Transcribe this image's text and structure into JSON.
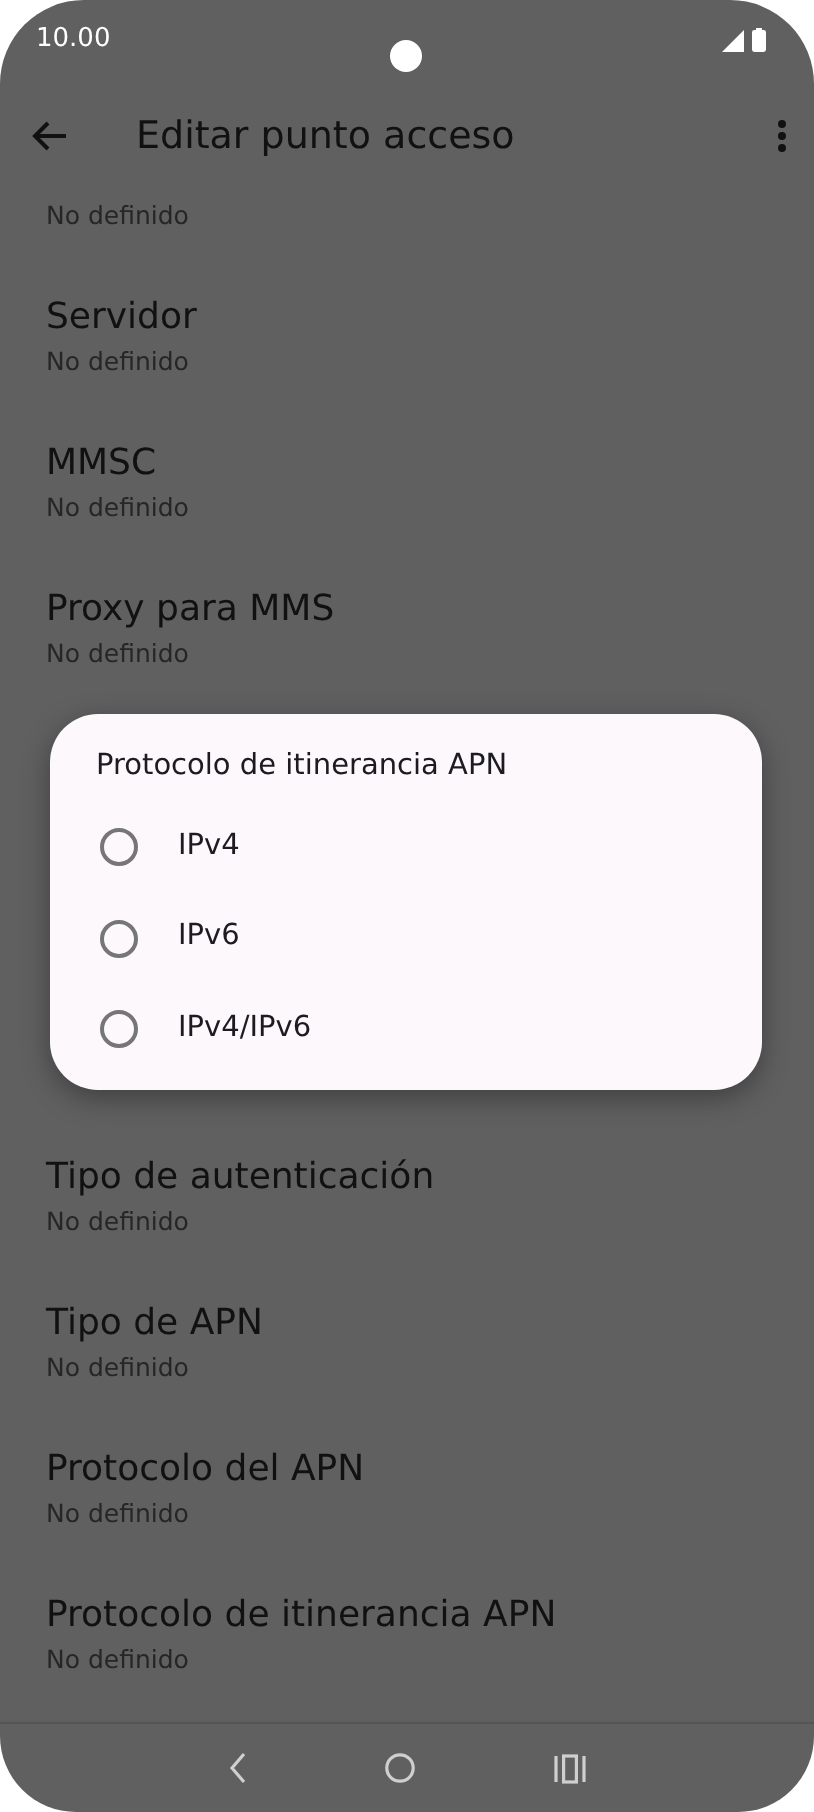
{
  "status_bar": {
    "time": "10.00"
  },
  "app_bar": {
    "title": "Editar punto acceso"
  },
  "items_before": [
    {
      "subtitle": "No definido"
    },
    {
      "title": "Servidor",
      "subtitle": "No definido"
    },
    {
      "title": "MMSC",
      "subtitle": "No definido"
    },
    {
      "title": "Proxy para MMS",
      "subtitle": "No definido"
    }
  ],
  "items_after": [
    {
      "title": "Tipo de autenticación",
      "subtitle": "No definido"
    },
    {
      "title": "Tipo de APN",
      "subtitle": "No definido"
    },
    {
      "title": "Protocolo del APN",
      "subtitle": "No definido"
    },
    {
      "title": "Protocolo de itinerancia APN",
      "subtitle": "No definido"
    }
  ],
  "dialog": {
    "title": "Protocolo de itinerancia APN",
    "options": [
      {
        "label": "IPv4",
        "selected": false
      },
      {
        "label": "IPv6",
        "selected": false
      },
      {
        "label": "IPv4/IPv6",
        "selected": false
      }
    ]
  }
}
